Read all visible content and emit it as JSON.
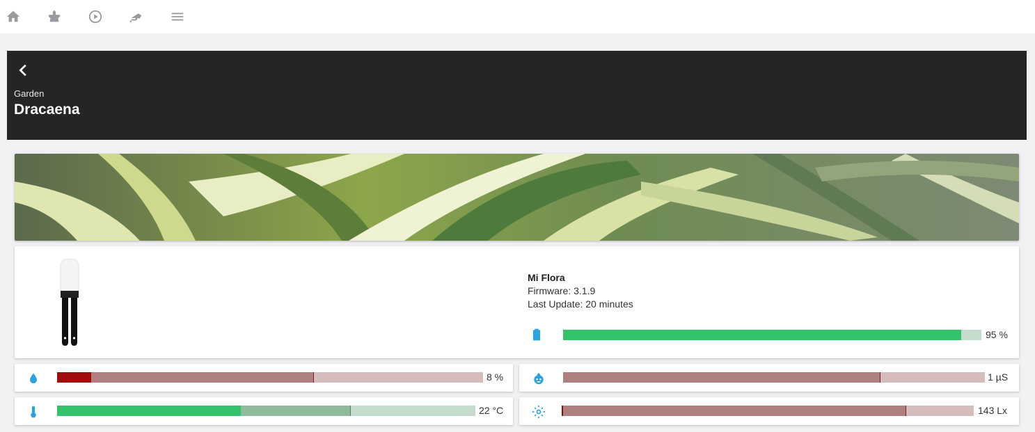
{
  "nav": {
    "items": [
      {
        "name": "home-icon"
      },
      {
        "name": "plant-icon"
      },
      {
        "name": "play-icon"
      },
      {
        "name": "camera-icon"
      },
      {
        "name": "menu-icon"
      }
    ]
  },
  "header": {
    "subtitle": "Garden",
    "title": "Dracaena"
  },
  "device": {
    "name": "Mi Flora",
    "firmware": "Firmware: 3.1.9",
    "last_update": "Last Update: 20 minutes",
    "battery": {
      "value": 95,
      "label": "95 %",
      "icon": "battery-icon"
    }
  },
  "meters": {
    "moisture": {
      "value": 8,
      "label": "8 %",
      "icon": "water-drop-icon"
    },
    "conductivity": {
      "value": 1,
      "label": "1 µS",
      "icon": "fertilizer-icon"
    },
    "temperature": {
      "value": 22,
      "label": "22 °C",
      "icon": "thermometer-icon"
    },
    "illuminance": {
      "value": 143,
      "label": "143 Lx",
      "icon": "sun-icon"
    }
  },
  "colors": {
    "good": "#34c26a",
    "good_mid": "#8fbb9c",
    "good_light": "#c5dbcc",
    "bad": "#a10d0d",
    "bad_mid": "#b08080",
    "bad_light": "#d6bdbd",
    "icon": "#2aa3e0",
    "header_bg": "#252528"
  }
}
